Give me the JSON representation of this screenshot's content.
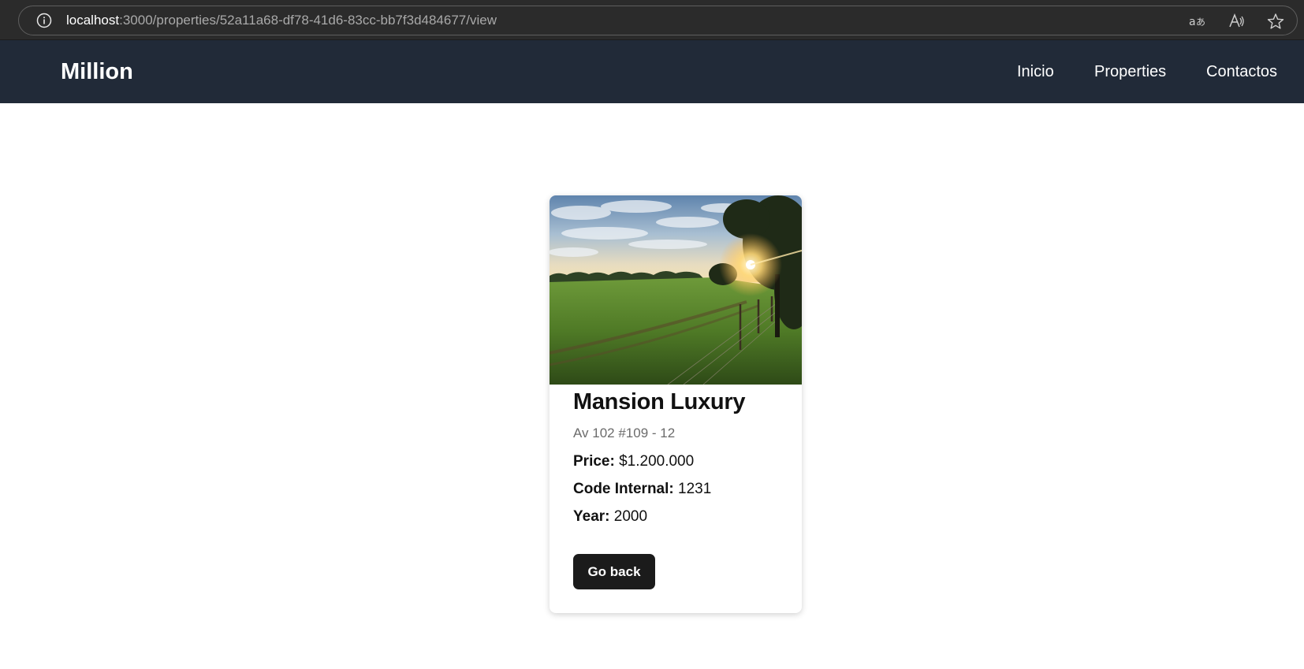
{
  "browser": {
    "url_host": "localhost",
    "url_rest": ":3000/properties/52a11a68-df78-41d6-83cc-bb7f3d484677/view",
    "icons": [
      "info-icon",
      "read-mode-icon",
      "read-aloud-icon",
      "favorite-star-icon"
    ]
  },
  "header": {
    "brand": "Million",
    "nav": [
      {
        "label": "Inicio"
      },
      {
        "label": "Properties"
      },
      {
        "label": "Contactos"
      }
    ],
    "background": "#212a38"
  },
  "property": {
    "name": "Mansion Luxury",
    "address": "Av 102 #109 - 12",
    "price_label": "Price:",
    "price_value": "$1.200.000",
    "code_label": "Code Internal:",
    "code_value": "1231",
    "year_label": "Year:",
    "year_value": "2000",
    "back_label": "Go back"
  }
}
